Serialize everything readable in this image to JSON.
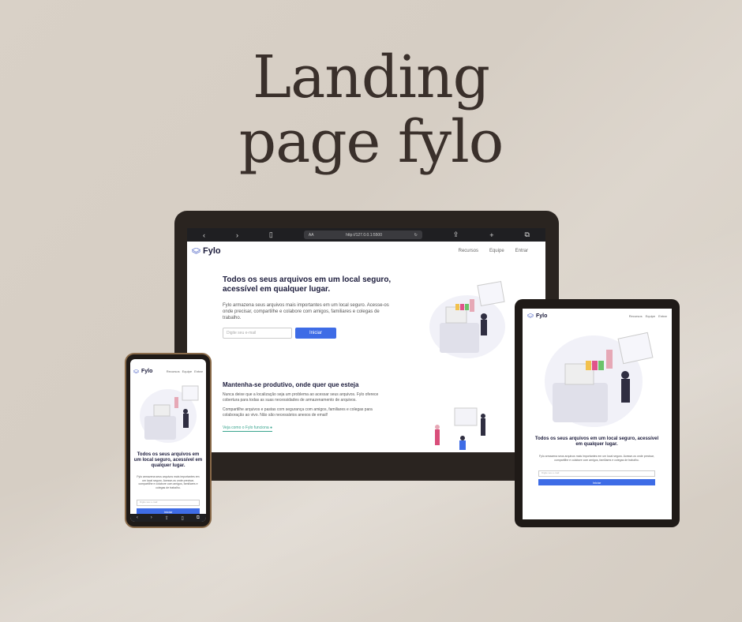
{
  "title": {
    "line1": "Landing",
    "line2": "page fylo"
  },
  "browser": {
    "url": "http://127.0.0.1:5500",
    "aa": "AA"
  },
  "site": {
    "logo": "Fylo",
    "nav": [
      "Recursos",
      "Equipe",
      "Entrar"
    ],
    "hero_title": "Todos os seus arquivos em um local seguro, acessível em qualquer lugar.",
    "hero_text": "Fylo armazena seus arquivos mais importantes em um local seguro. Acesse-os onde precisar, compartilhe e colabore com amigos, familiares e colegas de trabalho.",
    "email_placeholder": "Digite seu e-mail",
    "cta": "Iniciar",
    "section2_title": "Mantenha-se produtivo, onde quer que esteja",
    "section2_p1": "Nunca deixe que a localização seja um problema ao acessar seus arquivos. Fylo oferece cobertura para todas as suas necessidades de armazenamento de arquivos.",
    "section2_p2": "Compartilhe arquivos e pastas com segurança com amigos, familiares e colegas para colaboração ao vivo. Não são necessários anexos de email!",
    "section2_link": "Veja como o Fylo funciona"
  },
  "colors": {
    "accent": "#3e6ce6",
    "dark": "#1c1c3c",
    "teal": "#3aa58f",
    "background": "#d9d1c7"
  }
}
